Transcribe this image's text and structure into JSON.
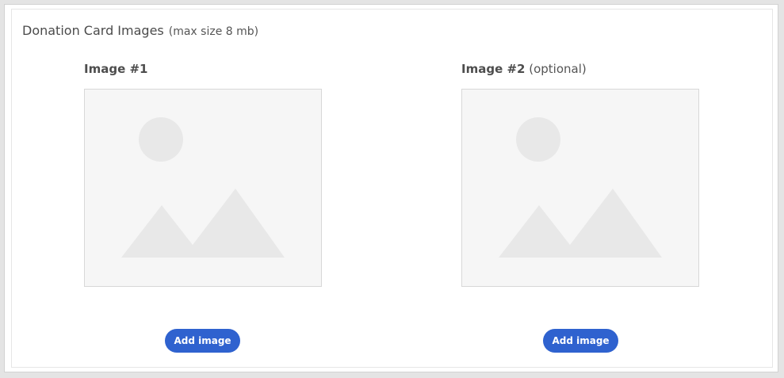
{
  "section": {
    "title": "Donation Card Images",
    "hint": "(max size 8 mb)"
  },
  "slots": [
    {
      "label": "Image #1",
      "suffix": "",
      "placeholder_icon": "image-placeholder-icon",
      "button_label": "Add image"
    },
    {
      "label": "Image #2",
      "suffix": " (optional)",
      "placeholder_icon": "image-placeholder-icon",
      "button_label": "Add image"
    }
  ],
  "colors": {
    "button": "#2f62cf",
    "placeholder_bg": "#f6f6f6",
    "placeholder_shape": "#e8e8e8"
  }
}
